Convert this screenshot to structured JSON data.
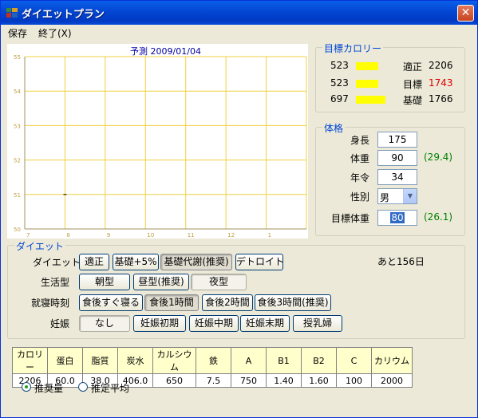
{
  "window": {
    "title": "ダイエットプラン",
    "close_label": "✕"
  },
  "menu": {
    "save": "保存",
    "exit": "終了(X)"
  },
  "chart_data": {
    "type": "line",
    "title": "予測 2009/01/04",
    "x_ticks": [
      "7",
      "8",
      "9",
      "10",
      "11",
      "12",
      "1"
    ],
    "y_ticks": [
      "50",
      "51",
      "52",
      "53",
      "54",
      "55"
    ],
    "ylim": [
      50,
      55
    ],
    "grid": true,
    "series": [
      {
        "values": [
          [
            8,
            51
          ]
        ]
      }
    ]
  },
  "calorie": {
    "title": "目標カロリー",
    "rows": [
      {
        "value": "523",
        "bar_fraction": 0.45,
        "label": "適正",
        "amount": "2206",
        "color": "#000000"
      },
      {
        "value": "523",
        "bar_fraction": 0.45,
        "label": "目標",
        "amount": "1743",
        "color": "#dd0000"
      },
      {
        "value": "697",
        "bar_fraction": 0.6,
        "label": "基礎",
        "amount": "1766",
        "color": "#000000"
      }
    ]
  },
  "body": {
    "title": "体格",
    "height_label": "身長",
    "height_value": "175",
    "weight_label": "体重",
    "weight_value": "90",
    "weight_bmi": "(29.4)",
    "age_label": "年令",
    "age_value": "34",
    "sex_label": "性別",
    "sex_value": "男",
    "target_label": "目標体重",
    "target_value": "80",
    "target_bmi": "(26.1)"
  },
  "diet": {
    "title": "ダイエット",
    "remaining": "あと156日",
    "rows": [
      {
        "label": "ダイエット",
        "buttons": [
          "適正",
          "基礎+5%",
          "基礎代謝(推奨)",
          "デトロイト"
        ]
      },
      {
        "label": "生活型",
        "buttons": [
          "朝型",
          "昼型(推奨)",
          "夜型"
        ]
      },
      {
        "label": "就寝時刻",
        "buttons": [
          "食後すぐ寝る",
          "食後1時間",
          "食後2時間",
          "食後3時間(推奨)"
        ]
      },
      {
        "label": "妊娠",
        "buttons": [
          "なし",
          "妊娠初期",
          "妊娠中期",
          "妊娠末期",
          "授乳婦"
        ]
      }
    ]
  },
  "nutrition": {
    "headers": [
      "カロリー",
      "蛋白",
      "脂質",
      "炭水",
      "カルシウム",
      "鉄",
      "A",
      "B1",
      "B2",
      "C",
      "カリウム"
    ],
    "values": [
      "2206",
      "60.0",
      "38.0",
      "406.0",
      "650",
      "7.5",
      "750",
      "1.40",
      "1.60",
      "100",
      "2000"
    ]
  },
  "options": {
    "recommended": "推奨量",
    "average": "推定平均"
  }
}
